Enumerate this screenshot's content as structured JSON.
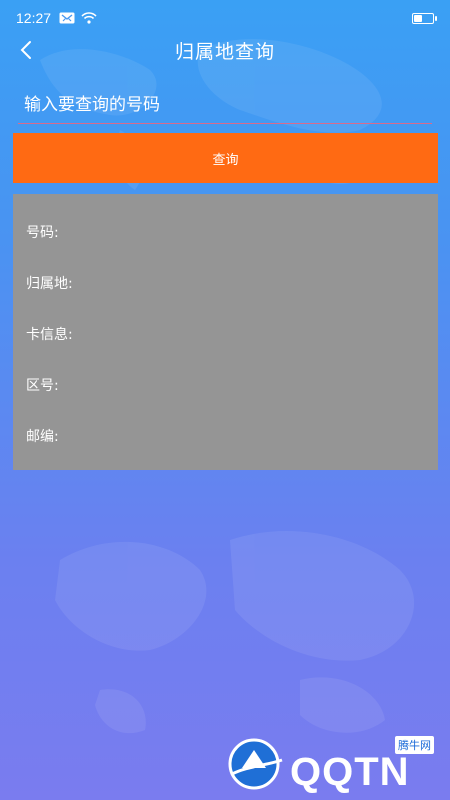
{
  "status_bar": {
    "time": "12:27",
    "battery_level": 0.45
  },
  "header": {
    "title": "归属地查询",
    "back_icon": "chevron-left-icon"
  },
  "search": {
    "placeholder": "输入要查询的号码",
    "value": ""
  },
  "query_button": {
    "label": "查询",
    "color": "#ff6a13"
  },
  "results": [
    {
      "label": "号码:",
      "value": ""
    },
    {
      "label": "归属地:",
      "value": ""
    },
    {
      "label": "卡信息:",
      "value": ""
    },
    {
      "label": "区号:",
      "value": ""
    },
    {
      "label": "邮编:",
      "value": ""
    }
  ],
  "watermark": {
    "logo_text": "QQTN",
    "badge_text": "腾牛网"
  },
  "colors": {
    "background_top": "#3aa0f4",
    "background_bottom": "#7a7cef",
    "panel": "#959595",
    "underline": "#d96b8d"
  }
}
